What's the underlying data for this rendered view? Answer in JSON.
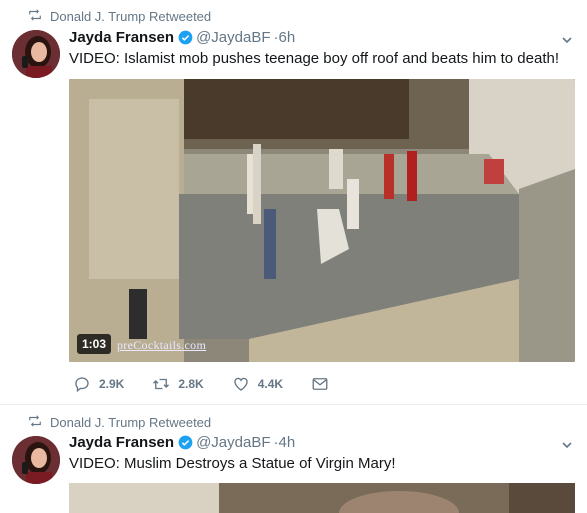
{
  "tweets": [
    {
      "retweeted_by": "Donald J. Trump Retweeted",
      "name": "Jayda Fransen",
      "handle": "@JaydaBF",
      "time": "·6h",
      "text": "VIDEO: Islamist mob pushes teenage boy off roof and beats him to death!",
      "video_duration": "1:03",
      "video_watermark": "preCocktails.com",
      "replies": "2.9K",
      "retweets": "2.8K",
      "likes": "4.4K"
    },
    {
      "retweeted_by": "Donald J. Trump Retweeted",
      "name": "Jayda Fransen",
      "handle": "@JaydaBF",
      "time": "·4h",
      "text": "VIDEO: Muslim Destroys a Statue of Virgin Mary!"
    }
  ],
  "colors": {
    "verified": "#1da1f2",
    "muted": "#657786",
    "text": "#14171a"
  },
  "icons": [
    "retweet-icon",
    "verified-icon",
    "chevron-down-icon",
    "reply-icon",
    "heart-icon",
    "envelope-icon"
  ]
}
